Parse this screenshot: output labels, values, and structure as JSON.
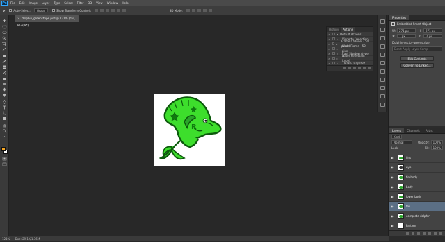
{
  "app": {
    "logo": "Ps"
  },
  "menu": [
    "File",
    "Edit",
    "Image",
    "Layer",
    "Type",
    "Select",
    "Filter",
    "3D",
    "View",
    "Window",
    "Help"
  ],
  "options": {
    "auto_select_label": "Auto-Select:",
    "auto_select_value": "Group",
    "show_transform": "Show Transform Controls",
    "mode_label": "3D Mode:"
  },
  "doc_tab": {
    "close": "×",
    "title": "dolphin_greenstripe.psd @ 121% (tail, RGB/8*)"
  },
  "status": {
    "zoom": "121%",
    "doc": "Doc: 29.1K/1.36M"
  },
  "actions_panel": {
    "tabs": [
      "History",
      "Actions"
    ],
    "rows": [
      {
        "label": "Default Actions",
        "folder": true
      },
      {
        "label": "Vignette (selection)"
      },
      {
        "label": "Frame Channel - 50 pixel"
      },
      {
        "label": "Wood Frame - 50 pixel"
      },
      {
        "label": "Cast Shadow (type)"
      },
      {
        "label": "Water Reflection (type)"
      },
      {
        "label": "Make snapshot"
      },
      {
        "label": "Convert Mode"
      }
    ]
  },
  "properties": {
    "tab": "Properties",
    "heading": "Embedded Smart Object",
    "w_label": "W:",
    "w_value": "271 px",
    "h_label": "H:",
    "h_value": "271 px",
    "x_label": "X:",
    "x_value": "1 px",
    "y_label": "Y:",
    "y_value": "-1 px",
    "source": "Dolphin-vector-greenstripe",
    "comp_placeholder": "Don't Apply Layer Comp",
    "edit_button": "Edit Contents",
    "convert_button": "Convert to Linked..."
  },
  "layers_panel": {
    "tabs": [
      "Layers",
      "Channels",
      "Paths"
    ],
    "kind": "Kind",
    "blend": "Normal",
    "opacity_label": "Opacity:",
    "opacity_value": "100%",
    "lock_label": "Lock:",
    "fill_label": "Fill:",
    "fill_value": "100%",
    "items": [
      {
        "name": "fins",
        "color": "#2aa52a",
        "selected": false
      },
      {
        "name": "eye",
        "color": "#333333",
        "selected": false
      },
      {
        "name": "fin body",
        "color": "#2aa52a",
        "selected": false
      },
      {
        "name": "body",
        "color": "#2aa52a",
        "selected": false
      },
      {
        "name": "lower body",
        "color": "#2aa52a",
        "selected": false
      },
      {
        "name": "tail",
        "color": "#2aa52a",
        "selected": true
      },
      {
        "name": "complete dolphin",
        "color": "#2aa52a",
        "selected": false
      },
      {
        "name": "Pattern",
        "color": "#ffffff",
        "selected": false
      }
    ]
  },
  "colors": {
    "accent": "#31a8ff",
    "fg": "#f5a623",
    "bg": "#ffffff",
    "art_green": "#3dde2c",
    "art_dark": "#0c5a0c"
  }
}
